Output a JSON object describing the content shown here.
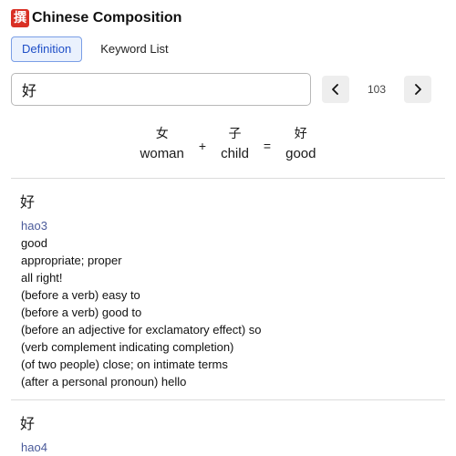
{
  "app": {
    "icon_char": "撰",
    "title": "Chinese Composition"
  },
  "tabs": [
    {
      "label": "Definition",
      "active": true
    },
    {
      "label": "Keyword List",
      "active": false
    }
  ],
  "search": {
    "value": "好",
    "placeholder": ""
  },
  "pager": {
    "prev_icon": "chevron-left-icon",
    "next_icon": "chevron-right-icon",
    "current": "103"
  },
  "composition": {
    "parts": [
      {
        "char": "女",
        "meaning": "woman"
      },
      {
        "char": "子",
        "meaning": "child"
      }
    ],
    "plus": "+",
    "equals": "=",
    "result": {
      "char": "好",
      "meaning": "good"
    }
  },
  "entries": [
    {
      "char": "好",
      "pinyin": "hao3",
      "definitions": [
        "good",
        "appropriate; proper",
        "all right!",
        "(before a verb) easy to",
        "(before a verb) good to",
        "(before an adjective for exclamatory effect) so",
        "(verb complement indicating completion)",
        "(of two people) close; on intimate terms",
        "(after a personal pronoun) hello"
      ]
    },
    {
      "char": "好",
      "pinyin": "hao4",
      "definitions": []
    }
  ],
  "colors": {
    "accent": "#1f4fc7",
    "tab_active_bg": "#eaf1fd",
    "pinyin": "#4a5a9a",
    "icon_bg": "#d93025"
  }
}
